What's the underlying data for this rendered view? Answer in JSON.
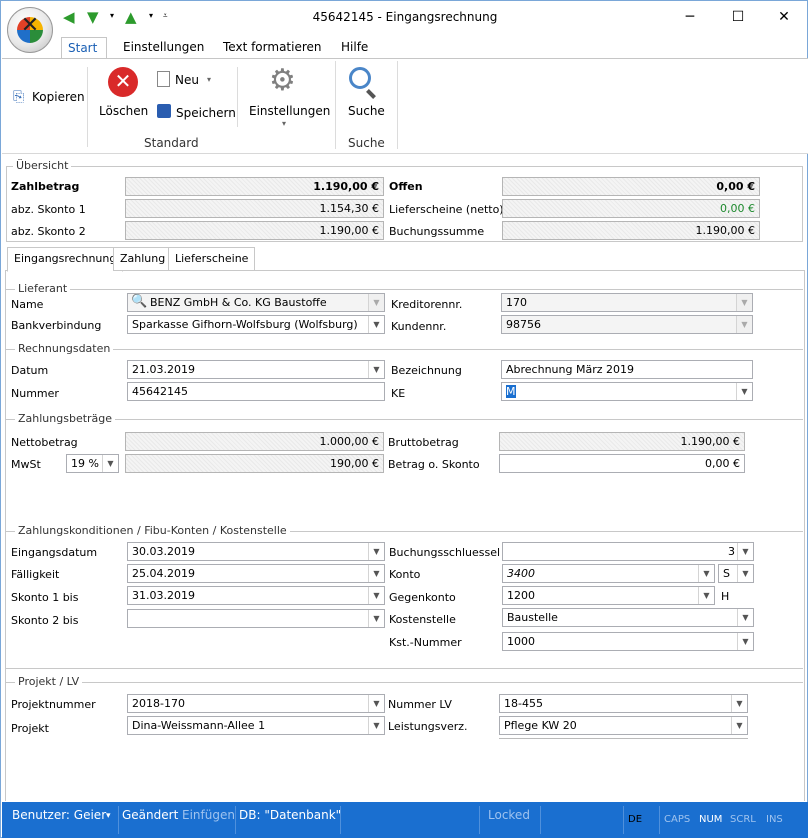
{
  "window": {
    "title": "45642145 - Eingangsrechnung"
  },
  "ribbon": {
    "tabs": [
      "Start",
      "Einstellungen",
      "Text formatieren",
      "Hilfe"
    ],
    "kopieren": "Kopieren",
    "loeschen": "Löschen",
    "neu": "Neu",
    "speichern": "Speichern",
    "einstellungen": "Einstellungen",
    "suche": "Suche",
    "group_standard": "Standard",
    "group_suche": "Suche"
  },
  "uebersicht": {
    "title": "Übersicht",
    "zahlbetrag_label": "Zahlbetrag",
    "zahlbetrag": "1.190,00 €",
    "skonto1_label": "abz. Skonto 1",
    "skonto1": "1.154,30 €",
    "skonto2_label": "abz. Skonto 2",
    "skonto2": "1.190,00 €",
    "offen_label": "Offen",
    "offen": "0,00 €",
    "lieferscheine_label": "Lieferscheine (netto)",
    "lieferscheine": "0,00 €",
    "buchungssumme_label": "Buchungssumme",
    "buchungssumme": "1.190,00 €"
  },
  "tabs": [
    "Eingangsrechnung",
    "Zahlung",
    "Lieferscheine"
  ],
  "lieferant": {
    "title": "Lieferant",
    "name_label": "Name",
    "name": "BENZ GmbH & Co. KG Baustoffe",
    "bank_label": "Bankverbindung",
    "bank": "Sparkasse Gifhorn-Wolfsburg (Wolfsburg)",
    "kreditor_label": "Kreditorennr.",
    "kreditor": "170",
    "kunden_label": "Kundennr.",
    "kunden": "98756"
  },
  "rechnung": {
    "title": "Rechnungsdaten",
    "datum_label": "Datum",
    "datum": "21.03.2019",
    "nummer_label": "Nummer",
    "nummer": "45642145",
    "bez_label": "Bezeichnung",
    "bez": "Abrechnung März 2019",
    "ke_label": "KE",
    "ke": "M"
  },
  "betraege": {
    "title": "Zahlungsbeträge",
    "netto_label": "Nettobetrag",
    "netto": "1.000,00 €",
    "mwst_label": "MwSt",
    "mwst_pct": "19 %",
    "mwst": "190,00 €",
    "brutto_label": "Bruttobetrag",
    "brutto": "1.190,00 €",
    "ohne_skonto_label": "Betrag o. Skonto",
    "ohne_skonto": "0,00 €"
  },
  "konditionen": {
    "title": "Zahlungskonditionen / Fibu-Konten / Kostenstelle",
    "eingang_label": "Eingangsdatum",
    "eingang": "30.03.2019",
    "faellig_label": "Fälligkeit",
    "faellig": "25.04.2019",
    "skonto1_label": "Skonto 1 bis",
    "skonto1": "31.03.2019",
    "skonto2_label": "Skonto 2 bis",
    "skonto2": "",
    "buchung_label": "Buchungsschluessel",
    "buchung": "3",
    "konto_label": "Konto",
    "konto": "3400",
    "konto_side": "S",
    "gegen_label": "Gegenkonto",
    "gegen": "1200",
    "gegen_side": "H",
    "kst_label": "Kostenstelle",
    "kst": "Baustelle",
    "kstnr_label": "Kst.-Nummer",
    "kstnr": "1000"
  },
  "projekt": {
    "title": "Projekt / LV",
    "nr_label": "Projektnummer",
    "nr": "2018-170",
    "projekt_label": "Projekt",
    "projekt": "Dina-Weissmann-Allee 1",
    "lv_label": "Nummer LV",
    "lv": "18-455",
    "verz_label": "Leistungsverz.",
    "verz": "Pflege KW 20"
  },
  "status": {
    "benutzer": "Benutzer: Geier",
    "geaendert": "Geändert",
    "einfuegen": "Einfügen",
    "db": "DB: \"Datenbank\"",
    "locked": "Locked",
    "lang": "DE",
    "caps": "CAPS",
    "num": "NUM",
    "scrl": "SCRL",
    "ins": "INS"
  },
  "colors": {
    "accent": "#1a6fd0",
    "green": "#1e8a2e"
  }
}
